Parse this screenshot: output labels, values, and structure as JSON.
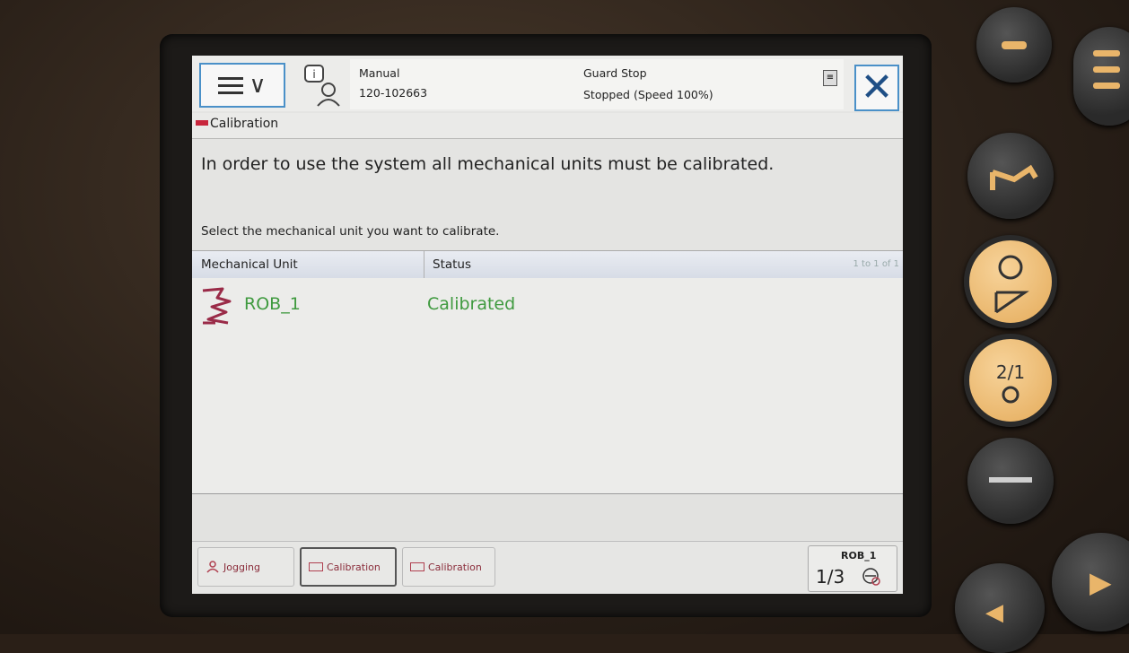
{
  "header": {
    "mode": "Manual",
    "system_id": "120-102663",
    "stop_state": "Guard Stop",
    "run_state": "Stopped (Speed 100%)"
  },
  "window": {
    "title": "Calibration"
  },
  "content": {
    "message": "In order to use the system all mechanical units must be calibrated.",
    "instruction": "Select the mechanical unit you want to calibrate."
  },
  "table": {
    "columns": [
      "Mechanical Unit",
      "Status"
    ],
    "range": "1 to 1 of 1",
    "rows": [
      {
        "unit": "ROB_1",
        "status": "Calibrated"
      }
    ]
  },
  "taskbar": {
    "items": [
      {
        "label": "Jogging",
        "icon": "jogging-icon"
      },
      {
        "label": "Calibration",
        "icon": "calibration-icon"
      },
      {
        "label": "Calibration",
        "icon": "calibration-icon"
      }
    ],
    "robot": {
      "name": "ROB_1",
      "speed_fraction": "1/3"
    }
  },
  "colors": {
    "accent_blue": "#4a90c8",
    "ok_green": "#3f9a3f",
    "brand_red": "#c8263c"
  }
}
